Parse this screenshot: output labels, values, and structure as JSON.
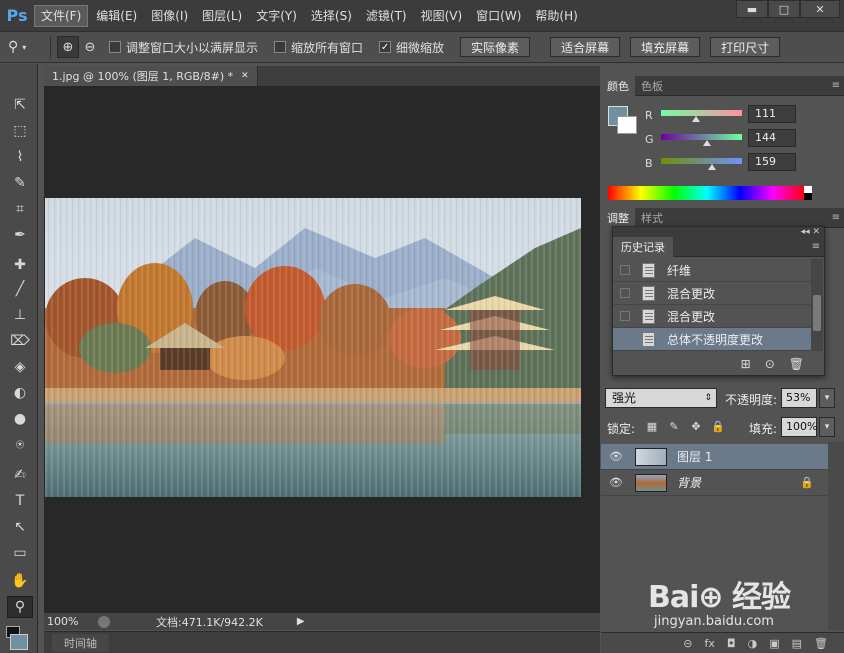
{
  "app": {
    "logo": "Ps"
  },
  "menu": [
    "文件(F)",
    "编辑(E)",
    "图像(I)",
    "图层(L)",
    "文字(Y)",
    "选择(S)",
    "滤镜(T)",
    "视图(V)",
    "窗口(W)",
    "帮助(H)"
  ],
  "window_controls": {
    "minimize": "▬",
    "restore": "□",
    "close": "✕"
  },
  "options": {
    "tool_glyph": "⚲",
    "zoom_in": "⊕",
    "zoom_out": "⊖",
    "resize_windows": {
      "label": "调整窗口大小以满屏显示",
      "checked": false
    },
    "zoom_all_windows": {
      "label": "缩放所有窗口",
      "checked": false
    },
    "scrubby_zoom": {
      "label": "细微缩放",
      "checked": true,
      "mark": "✓"
    },
    "buttons": [
      "实际像素",
      "适合屏幕",
      "填充屏幕",
      "打印尺寸"
    ]
  },
  "document": {
    "tab_title": "1.jpg @ 100% (图层 1, RGB/8#) *",
    "tab_close": "✕",
    "zoom": "100%",
    "doc_info": "文档:471.1K/942.2K",
    "status_arrow": "▶",
    "timeline_tab": "时间轴"
  },
  "tools": [
    "⇱",
    "⬚",
    "⌇",
    "✎",
    "⌗",
    "✒",
    "✚",
    "╱",
    "⊥",
    "⌦",
    "◈",
    "◐",
    "●",
    "⍟",
    "✍",
    "T",
    "↖",
    "▭",
    "✋",
    "⚲"
  ],
  "color_panel": {
    "tabs": [
      "颜色",
      "色板"
    ],
    "menu": "≡",
    "fg": "#6f90a0",
    "channels": [
      {
        "label": "R",
        "value": "111",
        "fraction": 0.435,
        "from": "#6fffa0",
        "to": "#ff90a0"
      },
      {
        "label": "G",
        "value": "144",
        "fraction": 0.565,
        "from": "#6f00a0",
        "to": "#6fffa0"
      },
      {
        "label": "B",
        "value": "159",
        "fraction": 0.624,
        "from": "#6f9000",
        "to": "#6f90ff"
      }
    ]
  },
  "adjust_panel": {
    "tabs": [
      "调整",
      "样式"
    ],
    "menu": "≡"
  },
  "history": {
    "header": "◂◂ ✕",
    "tab": "历史记录",
    "menu": "≡",
    "items": [
      {
        "label": "纤维",
        "selected": false
      },
      {
        "label": "混合更改",
        "selected": false
      },
      {
        "label": "混合更改",
        "selected": false
      },
      {
        "label": "总体不透明度更改",
        "selected": true
      }
    ],
    "footer": [
      "⊞",
      "⊙",
      "🗑"
    ]
  },
  "layers": {
    "blend_mode": "强光",
    "blend_arrow": "⇕",
    "opacity_label": "不透明度:",
    "opacity": "53%",
    "lock_label": "锁定:",
    "lock_icons": [
      "▦",
      "✎",
      "✥",
      "🔒"
    ],
    "fill_label": "填充:",
    "fill": "100%",
    "dropdown": "▾",
    "eye": "👁",
    "rows": [
      {
        "name": "图层 1",
        "selected": true,
        "italic": false,
        "locked": false
      },
      {
        "name": "背景",
        "selected": false,
        "italic": true,
        "locked": true
      }
    ],
    "lock_glyph": "🔒",
    "footer": [
      "⊝",
      "fx",
      "◘",
      "◑",
      "▣",
      "▤",
      "🗑"
    ]
  },
  "watermark": {
    "main": "Bai⊕ 经验",
    "sub": "jingyan.baidu.com"
  }
}
